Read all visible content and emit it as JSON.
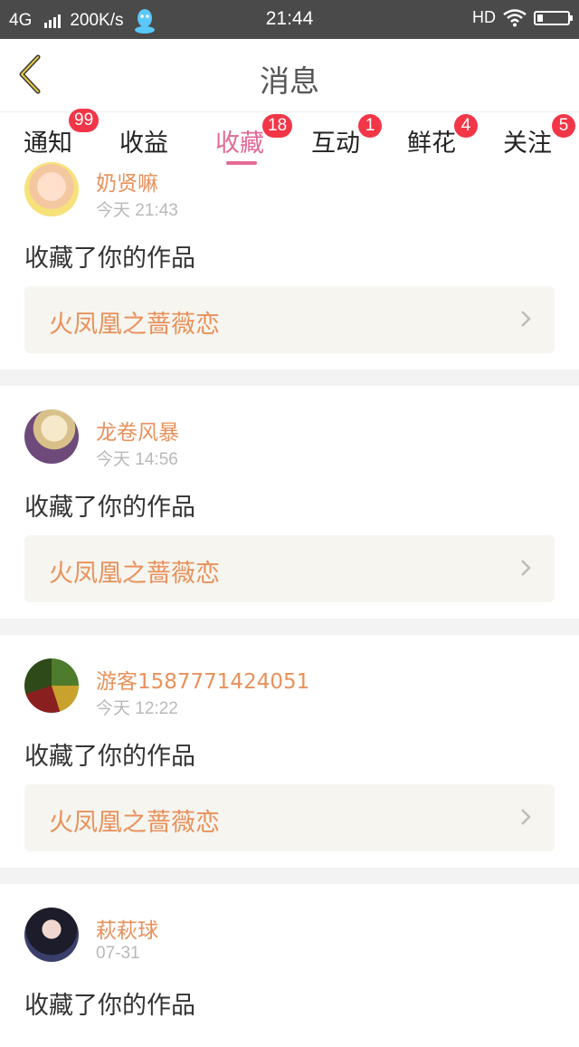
{
  "status_bar": {
    "network": "4G",
    "speed": "200K/s",
    "time": "21:44",
    "hd": "HD"
  },
  "header": {
    "title": "消息"
  },
  "tabs": [
    {
      "label": "通知",
      "badge": "99"
    },
    {
      "label": "收益",
      "badge": ""
    },
    {
      "label": "收藏",
      "badge": "18",
      "active": true
    },
    {
      "label": "互动",
      "badge": "1"
    },
    {
      "label": "鲜花",
      "badge": "4"
    },
    {
      "label": "关注",
      "badge": "5"
    }
  ],
  "items": [
    {
      "user": "奶贤嘛",
      "time": "今天 21:43",
      "action": "收藏了你的作品",
      "work": "火凤凰之蔷薇恋"
    },
    {
      "user": "龙卷风暴",
      "time": "今天 14:56",
      "action": "收藏了你的作品",
      "work": "火凤凰之蔷薇恋"
    },
    {
      "user": "游客1587771424051",
      "time": "今天 12:22",
      "action": "收藏了你的作品",
      "work": "火凤凰之蔷薇恋"
    },
    {
      "user": "萩萩球",
      "time": "07-31",
      "action": "收藏了你的作品",
      "work": ""
    }
  ],
  "colors": {
    "accent": "#e36a95",
    "name": "#e8915c",
    "badge": "#f23648",
    "work_bg": "#f6f5ef"
  }
}
